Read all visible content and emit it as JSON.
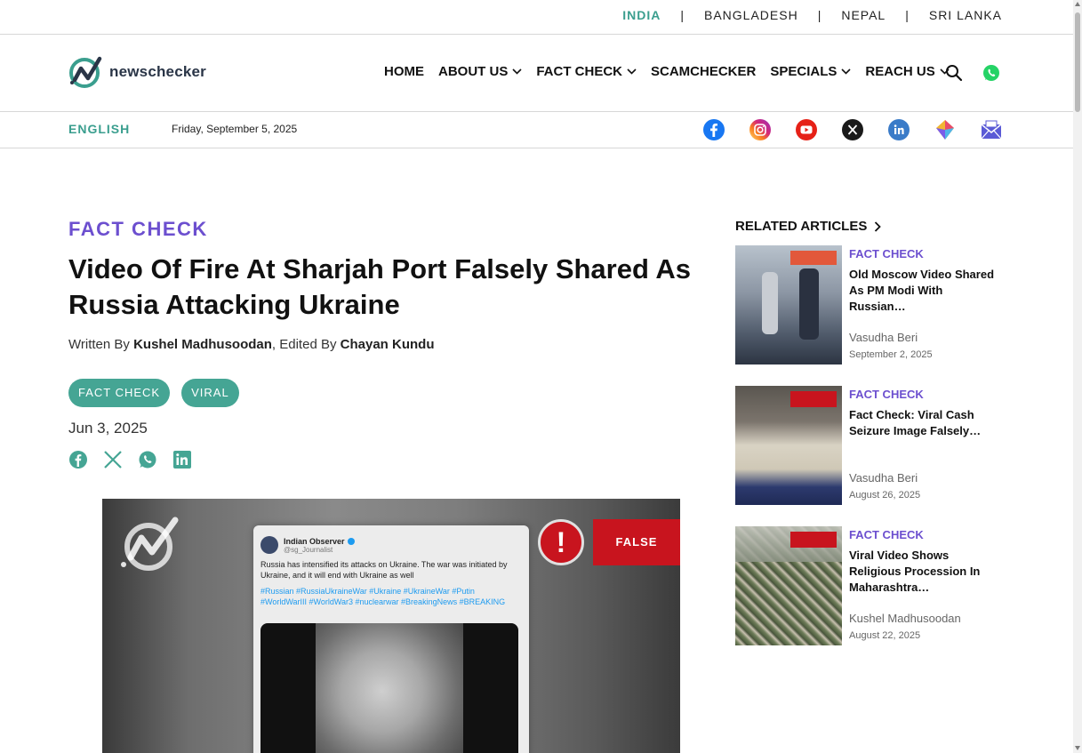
{
  "countries": {
    "india": "INDIA",
    "bangladesh": "BANGLADESH",
    "nepal": "NEPAL",
    "srilanka": "SRI LANKA",
    "separator": "|"
  },
  "brand": {
    "name": "newschecker",
    "accent": "#3a9e8e",
    "purple": "#6c4fcf"
  },
  "nav": {
    "home": "HOME",
    "about": "ABOUT US",
    "factcheck": "FACT CHECK",
    "scamchecker": "SCAMCHECKER",
    "specials": "SPECIALS",
    "reach": "REACH US"
  },
  "subheader": {
    "language": "ENGLISH",
    "date": "Friday, September 5, 2025",
    "social_icons": [
      "facebook-icon",
      "instagram-icon",
      "youtube-icon",
      "x-icon",
      "linkedin-icon",
      "gemini-icon",
      "email-icon"
    ]
  },
  "article": {
    "category": "FACT CHECK",
    "title": "Video Of Fire At Sharjah Port Falsely Shared As Russia Attacking Ukraine",
    "byline_written": "Written By ",
    "author": "Kushel Madhusoodan",
    "byline_edited": ", Edited By ",
    "editor": "Chayan Kundu",
    "tags": [
      "FACT CHECK",
      "VIRAL"
    ],
    "date": "Jun 3, 2025",
    "share_icons": [
      "facebook-icon",
      "x-icon",
      "whatsapp-icon",
      "linkedin-icon"
    ]
  },
  "hero": {
    "tweet_name": "Indian Observer",
    "tweet_handle": "@sg_Journalist",
    "tweet_text": "Russia has intensified its attacks on Ukraine. The war was initiated by Ukraine, and it will end with Ukraine as well",
    "tweet_tags": "#Russian #RussiaUkraineWar #Ukraine #UkraineWar #Putin #WorldWarIII #WorldWar3 #nuclearwar #BreakingNews #BREAKING",
    "warn_mark": "!",
    "verdict": "FALSE"
  },
  "related": {
    "title": "RELATED ARTICLES",
    "items": [
      {
        "category": "FACT CHECK",
        "title": "Old Moscow Video Shared As PM Modi With Russian…",
        "author": "Vasudha Beri",
        "date": "September 2, 2025"
      },
      {
        "category": "FACT CHECK",
        "title": "Fact Check: Viral Cash Seizure Image Falsely…",
        "author": "Vasudha Beri",
        "date": "August 26, 2025"
      },
      {
        "category": "FACT CHECK",
        "title": "Viral Video Shows Religious Procession In Maharashtra…",
        "author": "Kushel Madhusoodan",
        "date": "August 22, 2025"
      }
    ]
  }
}
